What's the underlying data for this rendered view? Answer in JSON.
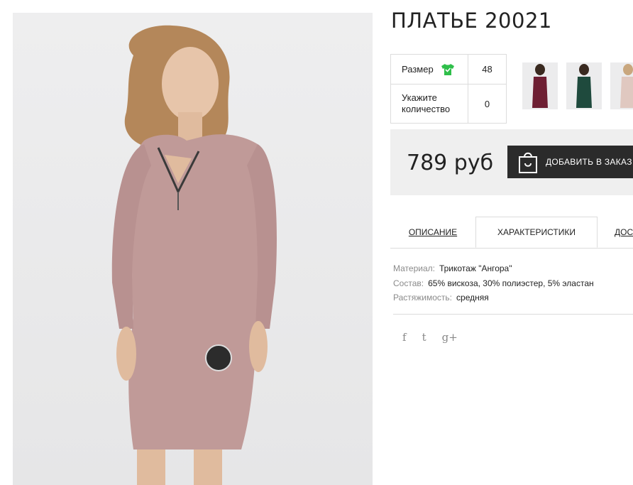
{
  "product": {
    "title": "ПЛАТЬЕ 20021",
    "price": "789 руб"
  },
  "options": {
    "size_label": "Размер",
    "size_value": "48",
    "qty_label": "Укажите количество",
    "qty_value": "0"
  },
  "cart_button": {
    "label": "ДОБАВИТЬ В ЗАКАЗ"
  },
  "tabs": [
    {
      "label": "ОПИСАНИЕ"
    },
    {
      "label": "ХАРАКТЕРИСТИКИ"
    },
    {
      "label": "ДОСТАВКА"
    }
  ],
  "specs": [
    {
      "key": "Материал:",
      "value": "Трикотаж \"Ангора\""
    },
    {
      "key": "Состав:",
      "value": "65% вискоза, 30% полиэстер, 5% эластан"
    },
    {
      "key": "Растяжимость:",
      "value": "средняя"
    }
  ],
  "thumbnails": [
    {
      "color": "#6e1f33"
    },
    {
      "color": "#1f4a3d"
    },
    {
      "color": "#e0c8c0"
    }
  ],
  "social": {
    "facebook": "f",
    "twitter": "t",
    "google_plus": "g+"
  },
  "colors": {
    "dress": "#c09a98",
    "button": "#2b2b2b",
    "price_bg": "#efefef",
    "size_icon": "#2fbf4a"
  }
}
